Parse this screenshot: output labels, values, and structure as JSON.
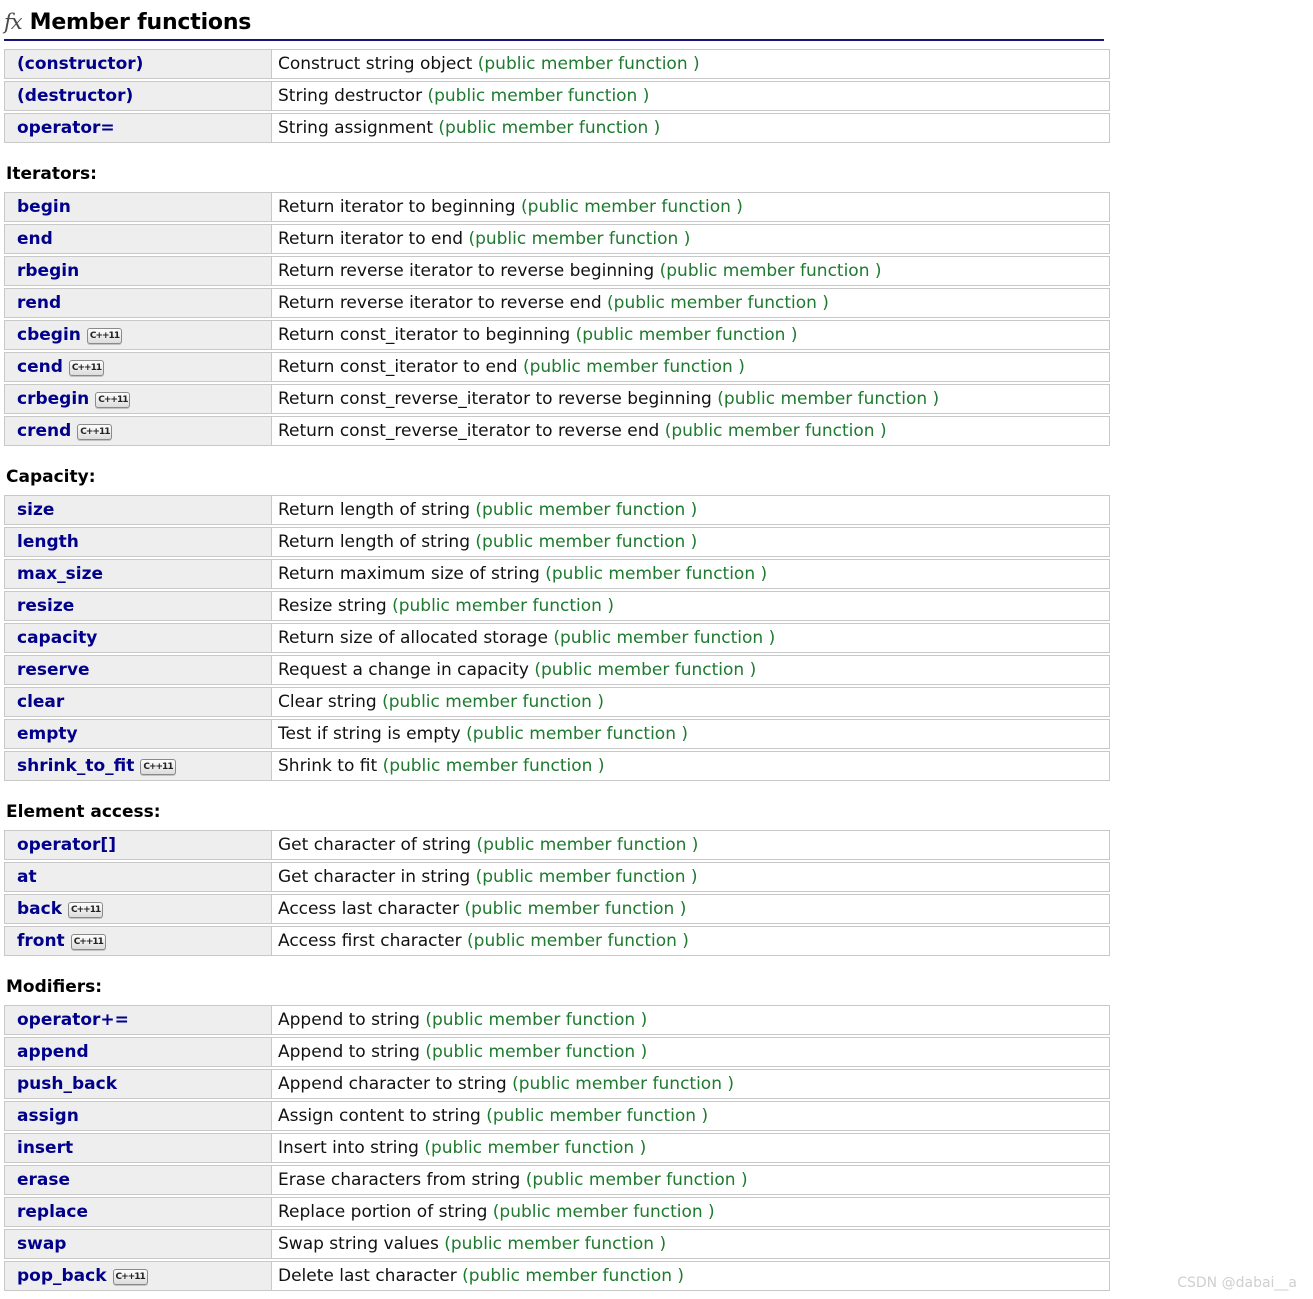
{
  "header": {
    "icon": "fx-icon",
    "icon_text": "fx",
    "title": "Member functions",
    "rule_color": "#14147a"
  },
  "colors": {
    "name_text": "#00008b",
    "kind_text": "#1d7a2e",
    "name_cell_bg": "#eeeeee",
    "border": "#c8c8c8",
    "watermark": "#cfcfcf"
  },
  "badge_label": "C++11",
  "groups": [
    {
      "heading": null,
      "rows": [
        {
          "name": "(constructor)",
          "badge": false,
          "desc": "Construct string object ",
          "kind": "(public member function )"
        },
        {
          "name": "(destructor)",
          "badge": false,
          "desc": "String destructor ",
          "kind": "(public member function )"
        },
        {
          "name": "operator=",
          "badge": false,
          "desc": "String assignment ",
          "kind": "(public member function )"
        }
      ]
    },
    {
      "heading": "Iterators:",
      "rows": [
        {
          "name": "begin",
          "badge": false,
          "desc": "Return iterator to beginning ",
          "kind": "(public member function )"
        },
        {
          "name": "end",
          "badge": false,
          "desc": "Return iterator to end ",
          "kind": "(public member function )"
        },
        {
          "name": "rbegin",
          "badge": false,
          "desc": "Return reverse iterator to reverse beginning ",
          "kind": "(public member function )"
        },
        {
          "name": "rend",
          "badge": false,
          "desc": "Return reverse iterator to reverse end ",
          "kind": "(public member function )"
        },
        {
          "name": "cbegin",
          "badge": true,
          "desc": "Return const_iterator to beginning ",
          "kind": "(public member function )"
        },
        {
          "name": "cend",
          "badge": true,
          "desc": "Return const_iterator to end ",
          "kind": "(public member function )"
        },
        {
          "name": "crbegin",
          "badge": true,
          "desc": "Return const_reverse_iterator to reverse beginning ",
          "kind": "(public member function )"
        },
        {
          "name": "crend",
          "badge": true,
          "desc": "Return const_reverse_iterator to reverse end ",
          "kind": "(public member function )"
        }
      ]
    },
    {
      "heading": "Capacity:",
      "rows": [
        {
          "name": "size",
          "badge": false,
          "desc": "Return length of string ",
          "kind": "(public member function )"
        },
        {
          "name": "length",
          "badge": false,
          "desc": "Return length of string ",
          "kind": "(public member function )"
        },
        {
          "name": "max_size",
          "badge": false,
          "desc": "Return maximum size of string ",
          "kind": "(public member function )"
        },
        {
          "name": "resize",
          "badge": false,
          "desc": "Resize string ",
          "kind": "(public member function )"
        },
        {
          "name": "capacity",
          "badge": false,
          "desc": "Return size of allocated storage ",
          "kind": "(public member function )"
        },
        {
          "name": "reserve",
          "badge": false,
          "desc": "Request a change in capacity ",
          "kind": "(public member function )"
        },
        {
          "name": "clear",
          "badge": false,
          "desc": "Clear string ",
          "kind": "(public member function )"
        },
        {
          "name": "empty",
          "badge": false,
          "desc": "Test if string is empty ",
          "kind": "(public member function )"
        },
        {
          "name": "shrink_to_fit",
          "badge": true,
          "desc": "Shrink to fit ",
          "kind": "(public member function )"
        }
      ]
    },
    {
      "heading": "Element access:",
      "rows": [
        {
          "name": "operator[]",
          "badge": false,
          "desc": "Get character of string ",
          "kind": "(public member function )"
        },
        {
          "name": "at",
          "badge": false,
          "desc": "Get character in string ",
          "kind": "(public member function )"
        },
        {
          "name": "back",
          "badge": true,
          "desc": "Access last character ",
          "kind": "(public member function )"
        },
        {
          "name": "front",
          "badge": true,
          "desc": "Access first character ",
          "kind": "(public member function )"
        }
      ]
    },
    {
      "heading": "Modifiers:",
      "rows": [
        {
          "name": "operator+=",
          "badge": false,
          "desc": "Append to string ",
          "kind": "(public member function )"
        },
        {
          "name": "append",
          "badge": false,
          "desc": "Append to string ",
          "kind": "(public member function )"
        },
        {
          "name": "push_back",
          "badge": false,
          "desc": "Append character to string ",
          "kind": "(public member function )"
        },
        {
          "name": "assign",
          "badge": false,
          "desc": "Assign content to string ",
          "kind": "(public member function )"
        },
        {
          "name": "insert",
          "badge": false,
          "desc": "Insert into string ",
          "kind": "(public member function )"
        },
        {
          "name": "erase",
          "badge": false,
          "desc": "Erase characters from string ",
          "kind": "(public member function )"
        },
        {
          "name": "replace",
          "badge": false,
          "desc": "Replace portion of string ",
          "kind": "(public member function )"
        },
        {
          "name": "swap",
          "badge": false,
          "desc": "Swap string values ",
          "kind": "(public member function )"
        },
        {
          "name": "pop_back",
          "badge": true,
          "desc": "Delete last character ",
          "kind": "(public member function )"
        }
      ]
    }
  ],
  "watermark": "CSDN @dabai__a"
}
